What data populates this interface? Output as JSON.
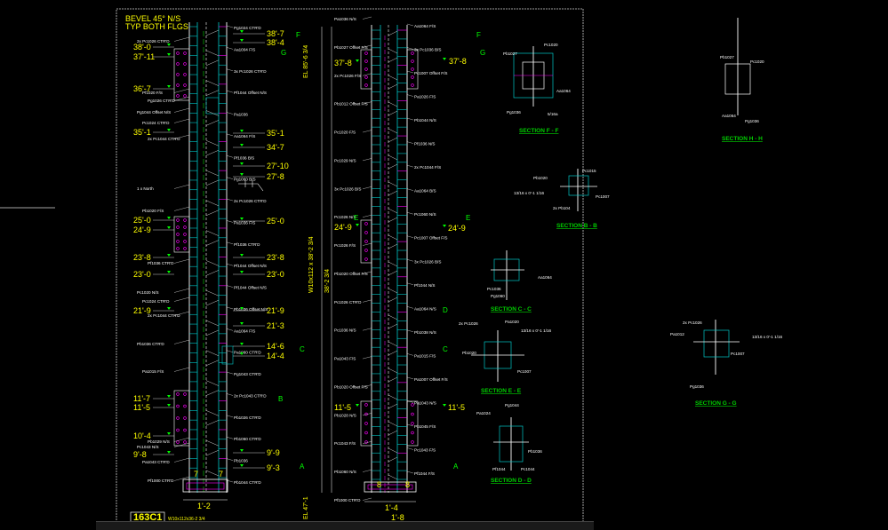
{
  "header_notes": [
    "BEVEL 45° N/S",
    "TYP BOTH FLGS"
  ],
  "drawing_id": "163C1",
  "drawing_sub": "W10x112x36-2 3/4",
  "left_column": {
    "elev_left": [
      "38'-0",
      "37'-11",
      "36'-7",
      "35'-1",
      "25'-0",
      "24'-9",
      "23'-8",
      "23'-0",
      "21'-9",
      "11'-7",
      "11'-5",
      "10'-4",
      "9'-8"
    ],
    "elev_right": [
      "38'-7",
      "38'-4",
      "35'-1",
      "34'-7",
      "27'-10",
      "27'-8",
      "25'-0",
      "23'-8",
      "23'-0",
      "21'-9",
      "21'-3",
      "14'-6",
      "14'-4",
      "9'-9",
      "9'-3"
    ],
    "notes_left": [
      "2x Pc1026 CTR'D",
      "Pf1020 F/S",
      "Pg1026 CTR'D",
      "Pg1044 Offset N/S",
      "Pc1024 CTR'D",
      "2x Pc1044 CTR'D",
      "1 x North",
      "Pb1020 F/S",
      "Pf1036 CTR'D",
      "Pc1020 N/S",
      "Pc1024 CTR'D",
      "2x Pc1044 CTR'D",
      "Pb1036 CTR'D",
      "Pa1015 F/S",
      "Pb1029 N/S",
      "Pc1043 N/S",
      "Pa1043 CTR'D",
      "Pf1000 CTR'D"
    ],
    "notes_right": [
      "Pg1024 CTR'D",
      "Aa1004 F/S",
      "3x Pc1026 CTR'D",
      "Pf1044 Offset N/S",
      "Pa1036",
      "Aa1064 F/S",
      "Pf1036 B/S",
      "Pg1060 B/S",
      "2x Pc1026 CTR'D",
      "Pa1036 F/S",
      "Pf1036 CTR'D",
      "Pf1044 Offset N/S",
      "Pf1044 Offset N/S",
      "Pb1036 Offset N/S",
      "Aa1064 F/S",
      "Pa1060 CTR'D",
      "Pg1043 CTR'D",
      "2x Pc1043 CTR'D",
      "Pb1026 CTR'D",
      "Pb1060 CTR'D",
      "Pb1036",
      "Pb1044 CTR'D"
    ],
    "bottom_dims": [
      "7",
      "7",
      "1'-2"
    ]
  },
  "right_column": {
    "elev_left": [
      "37'-8",
      "24'-9",
      "11'-5"
    ],
    "elev_right": [
      "37'-8",
      "24'-9",
      "11'-5"
    ],
    "vertical_labels": [
      "EL 85'-6 3/4",
      "W10x112 x 38'-2 3/4",
      "38'-2 3/4",
      "EL 47'-1"
    ],
    "notes_left": [
      "Pa1036 N/S",
      "Pb1027 Offset F/S",
      "2x Pc1026 F/S",
      "Pb1012 Offset F/S",
      "Pc1020 F/S",
      "Pc1029 N/S",
      "3x Pc1026 B/S",
      "Pc1026 N/S",
      "Pc1026 F/S",
      "Pb1020 Offset F/S",
      "Pc1026 CTR'D",
      "Pc1036 N/S",
      "Pa1043 F/S",
      "Pb1020 Offset F/S",
      "Pb1028 N/S",
      "Pc1043 F/S",
      "Pb1060 N/S",
      "Pf1000 CTR'D"
    ],
    "notes_right": [
      "Aa1064 F/S",
      "3x Pc1036 B/S",
      "Pc1007 Offset F/S",
      "Pa1026 F/S",
      "Pb1044 N/S",
      "Pf1036 N/S",
      "2x Pc1044 F/S",
      "Aa1064 B/S",
      "Pc1060 N/S",
      "Pc1007 Offset F/S",
      "3x Pc1026 B/S",
      "Pf1044 N/S",
      "Aa1064 N/S",
      "Pb1038 N/S",
      "Pa1015 F/S",
      "Pa1007 Offset F/S",
      "Pa1043 N/S",
      "Pb1045 F/S",
      "Pc1043 F/S",
      "Pf1044 F/S"
    ],
    "bottom_dims": [
      "8",
      "8",
      "1'-4",
      "1'-8"
    ]
  },
  "sections": [
    {
      "title": "SECTION F - F",
      "labels": [
        "Pb1027",
        "Pc1020",
        "Aa1064",
        "Pg1036",
        "5/16a"
      ]
    },
    {
      "title": "SECTION H - H",
      "labels": [
        "Pb1027",
        "Pc1020",
        "Aa1064",
        "Pg1036"
      ]
    },
    {
      "title": "SECTION B - B",
      "labels": [
        "Pb1020",
        "Pc1015",
        "Pc1007",
        "2x Pb104",
        "13/16 x 0'-1 1/16"
      ]
    },
    {
      "title": "SECTION C - C",
      "labels": [
        "Aa1064",
        "Pc1036",
        "Pg1060"
      ]
    },
    {
      "title": "SECTION E - E",
      "labels": [
        "2x Pc1026",
        "Pa1020",
        "Pb1020",
        "Pc1007",
        "13/16 x 0'-1 1/16"
      ]
    },
    {
      "title": "SECTION G - G",
      "labels": [
        "2x Pc1026",
        "Pa1012",
        "Pc1007",
        "Pg1036",
        "13/16 x 0'-1 1/16"
      ]
    },
    {
      "title": "SECTION D - D",
      "labels": [
        "Pg1044",
        "Pa1024",
        "Pb1036",
        "Pf1044",
        "Pc1044"
      ]
    }
  ],
  "markers": [
    "F",
    "G",
    "E",
    "D",
    "C",
    "B",
    "A"
  ],
  "colors": {
    "bg": "#000000",
    "line": "#ffffff",
    "dim": "#ffff00",
    "section": "#00d000",
    "cyan": "#00c8c8",
    "magenta": "#ff00ff",
    "green_mark": "#00ff00",
    "red_mark": "#ff2020"
  }
}
